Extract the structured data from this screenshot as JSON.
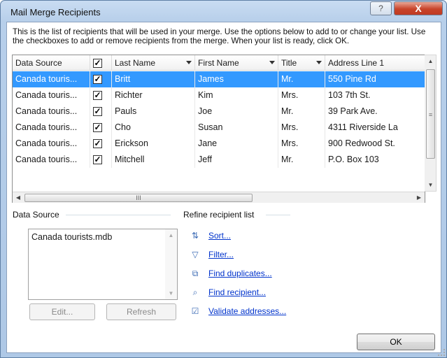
{
  "window": {
    "title": "Mail Merge Recipients",
    "help_glyph": "?",
    "close_glyph": "X"
  },
  "intro": "This is the list of recipients that will be used in your merge.  Use the options below to add to or change your list.  Use the checkboxes to add or remove recipients from the merge.  When your list is ready, click OK.",
  "table": {
    "columns": [
      "Data Source",
      "",
      "Last Name",
      "First Name",
      "Title",
      "Address Line 1"
    ],
    "rows": [
      {
        "source": "Canada touris...",
        "checked": "✓",
        "last": "Britt",
        "first": "James",
        "title": "Mr.",
        "address": "550 Pine Rd"
      },
      {
        "source": "Canada touris...",
        "checked": "✓",
        "last": "Richter",
        "first": "Kim",
        "title": "Mrs.",
        "address": "103 7th St."
      },
      {
        "source": "Canada touris...",
        "checked": "✓",
        "last": "Pauls",
        "first": "Joe",
        "title": "Mr.",
        "address": "39 Park Ave."
      },
      {
        "source": "Canada touris...",
        "checked": "✓",
        "last": "Cho",
        "first": "Susan",
        "title": "Mrs.",
        "address": "4311 Riverside La"
      },
      {
        "source": "Canada touris...",
        "checked": "✓",
        "last": "Erickson",
        "first": "Jane",
        "title": "Mrs.",
        "address": "900 Redwood St."
      },
      {
        "source": "Canada touris...",
        "checked": "✓",
        "last": "Mitchell",
        "first": "Jeff",
        "title": "Mr.",
        "address": "P.O. Box 103"
      }
    ],
    "header_check": "✓"
  },
  "data_source": {
    "label": "Data Source",
    "items": [
      "Canada tourists.mdb"
    ],
    "edit_label": "Edit...",
    "refresh_label": "Refresh"
  },
  "refine": {
    "label": "Refine recipient list",
    "links": [
      "Sort...",
      "Filter...",
      "Find duplicates...",
      "Find recipient...",
      "Validate addresses..."
    ]
  },
  "ok_label": "OK",
  "scroll": {
    "grip": "III"
  },
  "colors": {
    "selection": "#3399ff",
    "link": "#0033cc"
  }
}
